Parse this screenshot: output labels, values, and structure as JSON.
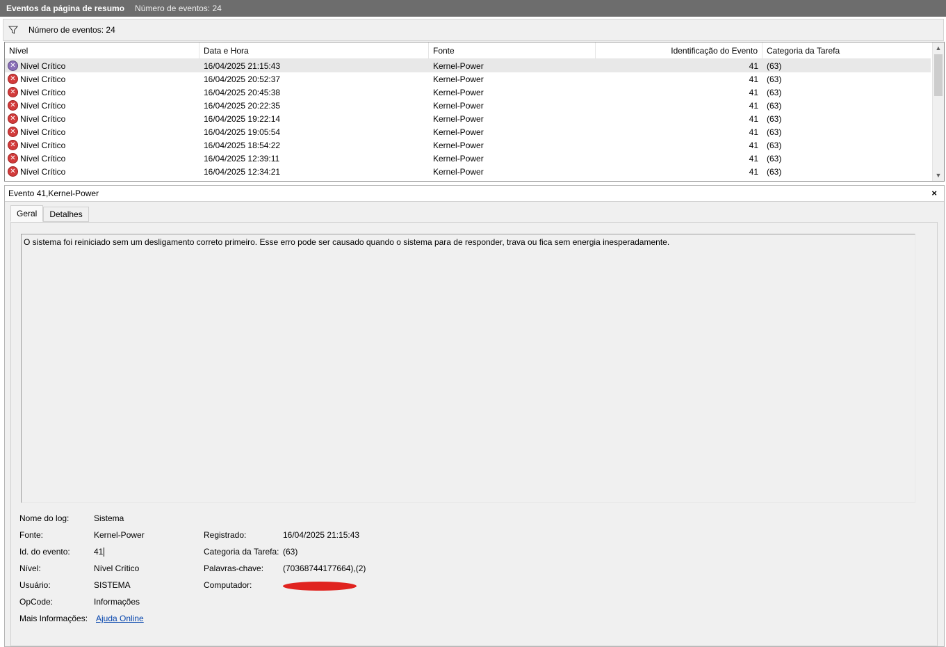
{
  "titlebar": {
    "title": "Eventos da página de resumo",
    "count": "Número de eventos: 24"
  },
  "filter": {
    "icon": "filter-icon",
    "text": "Número de eventos: 24"
  },
  "list": {
    "columns": [
      "Nível",
      "Data e Hora",
      "Fonte",
      "Identificação do Evento",
      "Categoria da Tarefa"
    ],
    "rows": [
      {
        "level": "Nível Crítico",
        "datetime": "16/04/2025 21:15:43",
        "source": "Kernel-Power",
        "event_id": "41",
        "category": "(63)"
      },
      {
        "level": "Nível Crítico",
        "datetime": "16/04/2025 20:52:37",
        "source": "Kernel-Power",
        "event_id": "41",
        "category": "(63)"
      },
      {
        "level": "Nível Crítico",
        "datetime": "16/04/2025 20:45:38",
        "source": "Kernel-Power",
        "event_id": "41",
        "category": "(63)"
      },
      {
        "level": "Nível Crítico",
        "datetime": "16/04/2025 20:22:35",
        "source": "Kernel-Power",
        "event_id": "41",
        "category": "(63)"
      },
      {
        "level": "Nível Crítico",
        "datetime": "16/04/2025 19:22:14",
        "source": "Kernel-Power",
        "event_id": "41",
        "category": "(63)"
      },
      {
        "level": "Nível Crítico",
        "datetime": "16/04/2025 19:05:54",
        "source": "Kernel-Power",
        "event_id": "41",
        "category": "(63)"
      },
      {
        "level": "Nível Crítico",
        "datetime": "16/04/2025 18:54:22",
        "source": "Kernel-Power",
        "event_id": "41",
        "category": "(63)"
      },
      {
        "level": "Nível Crítico",
        "datetime": "16/04/2025 12:39:11",
        "source": "Kernel-Power",
        "event_id": "41",
        "category": "(63)"
      },
      {
        "level": "Nível Crítico",
        "datetime": "16/04/2025 12:34:21",
        "source": "Kernel-Power",
        "event_id": "41",
        "category": "(63)"
      }
    ]
  },
  "detail": {
    "title": "Evento 41,Kernel-Power",
    "close": "×",
    "tabs": [
      "Geral",
      "Detalhes"
    ],
    "description": "O sistema foi reiniciado sem um desligamento correto primeiro. Esse erro pode ser causado quando o sistema para de responder, trava ou fica sem energia inesperadamente.",
    "props": {
      "log_name_label": "Nome do log:",
      "log_name": "Sistema",
      "source_label": "Fonte:",
      "source": "Kernel-Power",
      "registered_label": "Registrado:",
      "registered": "16/04/2025 21:15:43",
      "event_id_label": "Id. do evento:",
      "event_id": "41",
      "task_category_label": "Categoria da Tarefa:",
      "task_category": "(63)",
      "level_label": "Nível:",
      "level": "Nível Crítico",
      "keywords_label": "Palavras-chave:",
      "keywords": "(70368744177664),(2)",
      "user_label": "Usuário:",
      "user": "SISTEMA",
      "computer_label": "Computador:",
      "opcode_label": "OpCode:",
      "opcode": "Informações",
      "more_info_label": "Mais Informações:",
      "more_info_link": "Ajuda Online"
    }
  }
}
